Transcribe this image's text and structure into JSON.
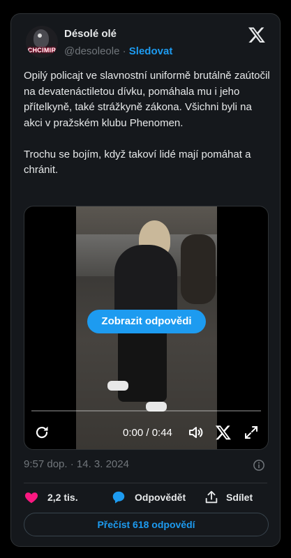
{
  "author": {
    "name": "Désolé olé",
    "handle": "@desoleole",
    "separator": "·",
    "follow_label": "Sledovat",
    "avatar_text": "CHCIMIR"
  },
  "tweet": {
    "paragraphs": [
      "Opilý policajt ve slavnostní uniformě brutálně zaútočil na devatenáctiletou dívku, pomáhala mu i jeho přítelkyně, také strážkyně zákona. Všichni byli na akci v pražském klubu Phenomen.",
      "Trochu se bojím, když takoví lidé mají pomáhat a chránit."
    ],
    "timestamp": "9:57 dop. · 14. 3. 2024"
  },
  "video": {
    "show_replies_label": "Zobrazit odpovědi",
    "time_display": "0:00 / 0:44",
    "progress": 0
  },
  "actions": {
    "likes": "2,2 tis.",
    "reply_label": "Odpovědět",
    "share_label": "Sdílet"
  },
  "read_replies_label": "Přečíst 618 odpovědí",
  "colors": {
    "background": "#000000",
    "card": "#15181c",
    "accent": "#1d9bf0",
    "like": "#f91880",
    "muted": "#71767b"
  }
}
